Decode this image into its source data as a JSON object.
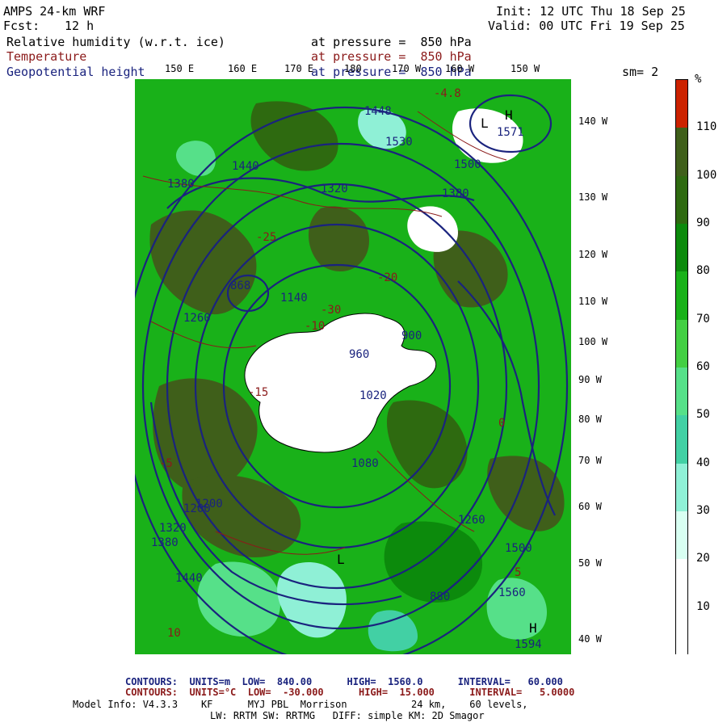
{
  "header": {
    "model": "AMPS 24-km WRF",
    "init": "Init: 12 UTC Thu 18 Sep 25",
    "fcst_label": "Fcst:",
    "fcst_value": "12 h",
    "valid": "Valid: 00 UTC Fri 19 Sep 25",
    "field1": "Relative humidity (w.r.t. ice)",
    "field1_level": "at pressure =  850 hPa",
    "field2": "Temperature",
    "field2_level": "at pressure =  850 hPa",
    "field3": "Geopotential height",
    "field3_level": "at pressure =  850 hPa",
    "smoothing": "sm= 2"
  },
  "lon_labels": [
    "150 E",
    "160 E",
    "170 E",
    "180",
    "170 W",
    "160 W",
    "150 W"
  ],
  "lat_labels": [
    "140 W",
    "130 W",
    "120 W",
    "110 W",
    "100 W",
    "90 W",
    "80 W",
    "70 W",
    "60 W",
    "50 W",
    "40 W"
  ],
  "colorbar": {
    "unit": "%",
    "ticks": [
      "110",
      "100",
      "90",
      "80",
      "70",
      "60",
      "50",
      "40",
      "30",
      "20",
      "10"
    ],
    "colors": [
      "#cc2200",
      "#3f5f1a",
      "#2e6a10",
      "#0c8a0c",
      "#19b119",
      "#43cf43",
      "#56e089",
      "#42d0a4",
      "#8ff0d6",
      "#d8fff2",
      "#ffffff",
      "#ffffff"
    ]
  },
  "map": {
    "height_labels": [
      "1448",
      "1530",
      "1500",
      "1380",
      "1440",
      "1380",
      "1320",
      "1260",
      "1200",
      "1140",
      "1080",
      "1020",
      "960",
      "900",
      "868",
      "880",
      "1571",
      "1594",
      "1560",
      "1500",
      "1320",
      "1380",
      "1440",
      "1200",
      "1260"
    ],
    "temp_labels": [
      "-4.8",
      "-10",
      "-15",
      "-20",
      "-25",
      "-30",
      "-5",
      "0",
      "5",
      "10"
    ],
    "high_markers": [
      "H",
      "H"
    ],
    "low_markers": [
      "L",
      "L"
    ]
  },
  "footer": {
    "contours1": "CONTOURS:  UNITS=m  LOW=  840.00      HIGH=  1560.0      INTERVAL=   60.000",
    "contours2": "CONTOURS:  UNITS=°C  LOW=  -30.000      HIGH=  15.000      INTERVAL=   5.0000",
    "model_info": "Model Info: V4.3.3    KF      MYJ PBL  Morrison           24 km,    60 levels,",
    "model_info2": "LW: RRTM SW: RRTMG   DIFF: simple KM: 2D Smagor"
  }
}
